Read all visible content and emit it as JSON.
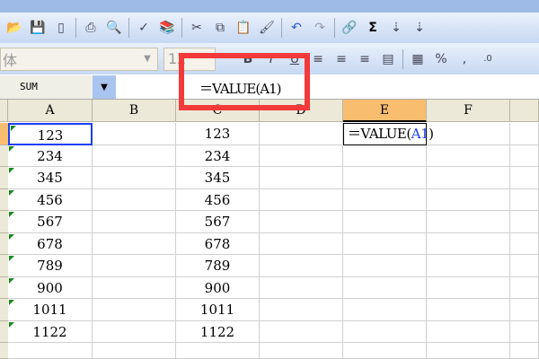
{
  "toolbar": {
    "font_name": "体",
    "font_size": "12",
    "icons": [
      "open-icon",
      "save-icon",
      "permission-icon",
      "print-icon",
      "print-preview-icon",
      "spelling-icon",
      "research-icon",
      "cut-icon",
      "copy-icon",
      "paste-icon",
      "format-painter-icon",
      "undo-icon",
      "redo-icon",
      "hyperlink-icon",
      "autosum-icon",
      "sort-ascending-icon",
      "sort-descending-icon"
    ],
    "autosum": "Σ",
    "percent": "%",
    "comma": ",",
    "decimal": ".0"
  },
  "formula_bar": {
    "name_box": "SUM",
    "formula": "＝VALUE(A1)"
  },
  "columns": [
    "A",
    "B",
    "C",
    "D",
    "E",
    "F"
  ],
  "rows": [
    {
      "a": "123",
      "c": "123"
    },
    {
      "a": "234",
      "c": "234"
    },
    {
      "a": "345",
      "c": "345"
    },
    {
      "a": "456",
      "c": "456"
    },
    {
      "a": "567",
      "c": "567"
    },
    {
      "a": "678",
      "c": "678"
    },
    {
      "a": "789",
      "c": "789"
    },
    {
      "a": "900",
      "c": "900"
    },
    {
      "a": "1011",
      "c": "1011"
    },
    {
      "a": "1122",
      "c": "1122"
    }
  ],
  "edit_cell": {
    "prefix": "＝VALUE(",
    "ref": "A1",
    "suffix": ")"
  },
  "colors": {
    "highlight": "#f23a3a",
    "selected_header": "#f9bd70"
  }
}
